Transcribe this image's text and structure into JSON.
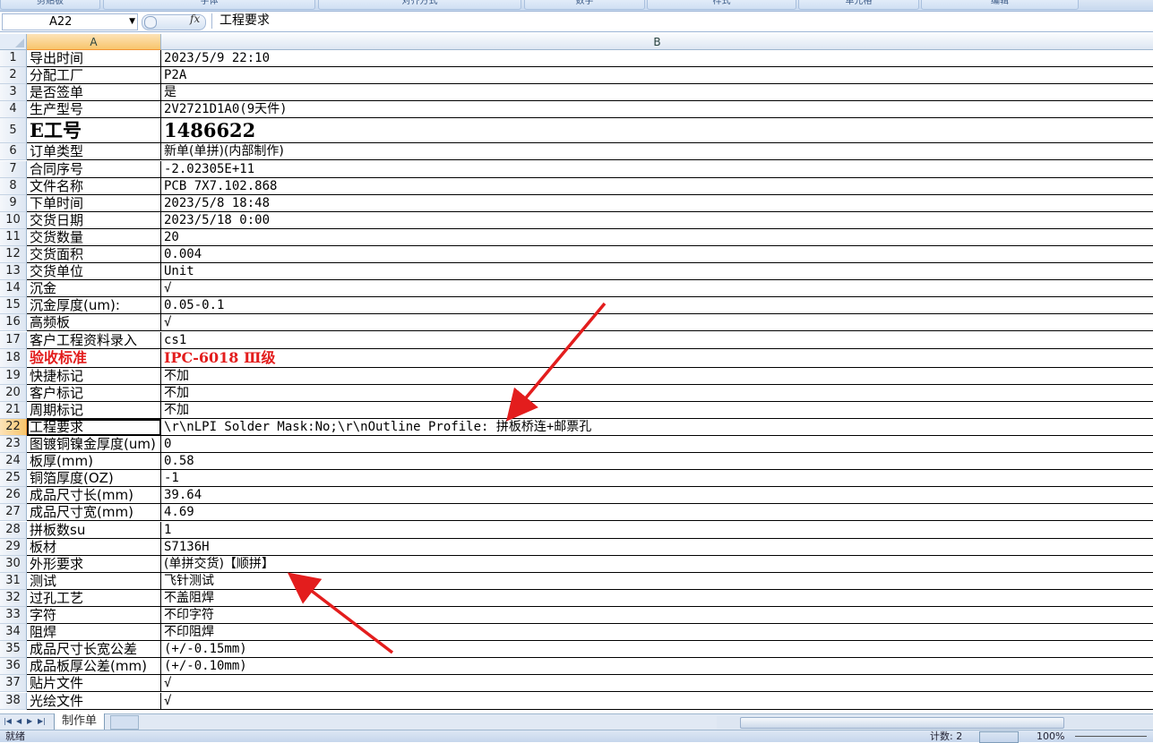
{
  "ribbon": {
    "groups": [
      "剪贴板",
      "字体",
      "对齐方式",
      "数字",
      "样式",
      "单元格",
      "编辑"
    ]
  },
  "formula": {
    "name_box": "A22",
    "fx": "fx",
    "content": "工程要求"
  },
  "columns": [
    "A",
    "B"
  ],
  "rows": [
    {
      "n": "1",
      "a": "导出时间",
      "b": "2023/5/9 22:10"
    },
    {
      "n": "2",
      "a": "分配工厂",
      "b": "P2A"
    },
    {
      "n": "3",
      "a": "是否签单",
      "b": "是"
    },
    {
      "n": "4",
      "a": "生产型号",
      "b": "2V2721D1A0(9天件)"
    },
    {
      "n": "5",
      "a": "E工号",
      "b": "1486622"
    },
    {
      "n": "6",
      "a": "订单类型",
      "b": "新单(单拼)(内部制作)"
    },
    {
      "n": "7",
      "a": "合同序号",
      "b": "-2.02305E+11"
    },
    {
      "n": "8",
      "a": "文件名称",
      "b": "PCB 7X7.102.868"
    },
    {
      "n": "9",
      "a": "下单时间",
      "b": "2023/5/8 18:48"
    },
    {
      "n": "10",
      "a": "交货日期",
      "b": "2023/5/18 0:00"
    },
    {
      "n": "11",
      "a": "交货数量",
      "b": "20"
    },
    {
      "n": "12",
      "a": "交货面积",
      "b": "0.004"
    },
    {
      "n": "13",
      "a": "交货单位",
      "b": "Unit"
    },
    {
      "n": "14",
      "a": "沉金",
      "b": "√"
    },
    {
      "n": "15",
      "a": "沉金厚度(um):",
      "b": "0.05-0.1"
    },
    {
      "n": "16",
      "a": "高频板",
      "b": "√"
    },
    {
      "n": "17",
      "a": "客户工程资料录入",
      "b": "cs1"
    },
    {
      "n": "18",
      "a": "验收标准",
      "b": "IPC-6018 Ⅲ级"
    },
    {
      "n": "19",
      "a": "快捷标记",
      "b": "不加"
    },
    {
      "n": "20",
      "a": "客户标记",
      "b": "不加"
    },
    {
      "n": "21",
      "a": "周期标记",
      "b": "不加"
    },
    {
      "n": "22",
      "a": "工程要求",
      "b": "\\r\\nLPI Solder Mask:No;\\r\\nOutline Profile: 拼板桥连+邮票孔"
    },
    {
      "n": "23",
      "a": "图镀铜镍金厚度(um)",
      "b": "0"
    },
    {
      "n": "24",
      "a": "板厚(mm)",
      "b": "0.58"
    },
    {
      "n": "25",
      "a": "铜箔厚度(OZ)",
      "b": "-1"
    },
    {
      "n": "26",
      "a": "成品尺寸长(mm)",
      "b": "39.64"
    },
    {
      "n": "27",
      "a": "成品尺寸宽(mm)",
      "b": "4.69"
    },
    {
      "n": "28",
      "a": "拼板数su",
      "b": "1"
    },
    {
      "n": "29",
      "a": "板材",
      "b": "S7136H"
    },
    {
      "n": "30",
      "a": "外形要求",
      "b": "(单拼交货)【顺拼】"
    },
    {
      "n": "31",
      "a": "测试",
      "b": "飞针测试"
    },
    {
      "n": "32",
      "a": "过孔工艺",
      "b": "不盖阻焊"
    },
    {
      "n": "33",
      "a": "字符",
      "b": "不印字符"
    },
    {
      "n": "34",
      "a": "阻焊",
      "b": "不印阻焊"
    },
    {
      "n": "35",
      "a": "成品尺寸长宽公差",
      "b": "(+/-0.15mm)"
    },
    {
      "n": "36",
      "a": "成品板厚公差(mm)",
      "b": "(+/-0.10mm)"
    },
    {
      "n": "37",
      "a": "贴片文件",
      "b": "√"
    },
    {
      "n": "38",
      "a": "光绘文件",
      "b": "√"
    }
  ],
  "sheet_tab": "制作单",
  "status": {
    "ready": "就绪",
    "count": "计数: 2",
    "zoom": "100%"
  },
  "colors": {
    "annotation": "#e31d1d",
    "active_header": "#f8c56c"
  }
}
